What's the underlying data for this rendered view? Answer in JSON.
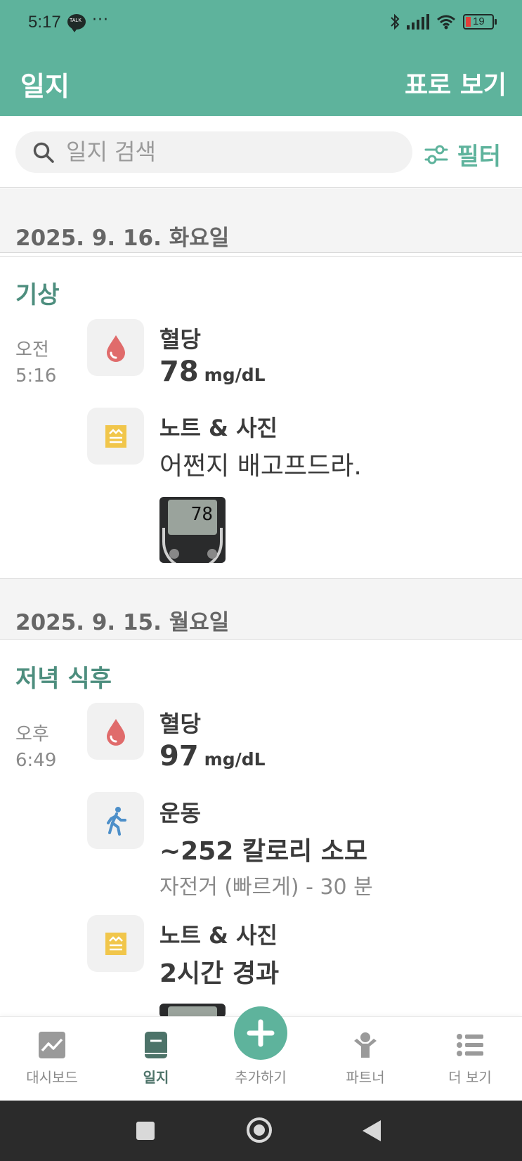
{
  "status_bar": {
    "time": "5:17",
    "talk_badge": "TALK",
    "more": "···",
    "battery": "19"
  },
  "header": {
    "title": "일지",
    "table_view": "표로 보기"
  },
  "search": {
    "placeholder": "일지 검색",
    "filter_label": "필터"
  },
  "colors": {
    "accent": "#5eb39c",
    "section_title": "#4d8e7e",
    "blood_drop": "#e06b6b",
    "note_icon": "#f1c64b",
    "exercise_icon": "#4d8fc9"
  },
  "days": [
    {
      "date": "2025. 9. 16. 화요일",
      "section": "기상",
      "time_ampm": "오전",
      "time": "5:16",
      "entries": {
        "glucose_label": "혈당",
        "glucose_value": "78",
        "glucose_unit": "mg/dL",
        "note_label": "노트 & 사진",
        "note_text": "어쩐지 배고프드라.",
        "photo_reading": "78"
      }
    },
    {
      "date": "2025. 9. 15. 월요일",
      "section": "저녁 식후",
      "time_ampm": "오후",
      "time": "6:49",
      "entries": {
        "glucose_label": "혈당",
        "glucose_value": "97",
        "glucose_unit": "mg/dL",
        "exercise_label": "운동",
        "exercise_value": "~252 칼로리 소모",
        "exercise_detail": "자전거 (빠르게) - 30 분",
        "note_label": "노트 & 사진",
        "note_text": "2시간 경과"
      }
    }
  ],
  "bottom_nav": [
    {
      "label": "대시보드",
      "icon": "dashboard-icon"
    },
    {
      "label": "일지",
      "icon": "journal-icon",
      "active": true
    },
    {
      "label": "추가하기",
      "icon": "plus-icon"
    },
    {
      "label": "파트너",
      "icon": "partner-icon"
    },
    {
      "label": "더 보기",
      "icon": "more-list-icon"
    }
  ]
}
